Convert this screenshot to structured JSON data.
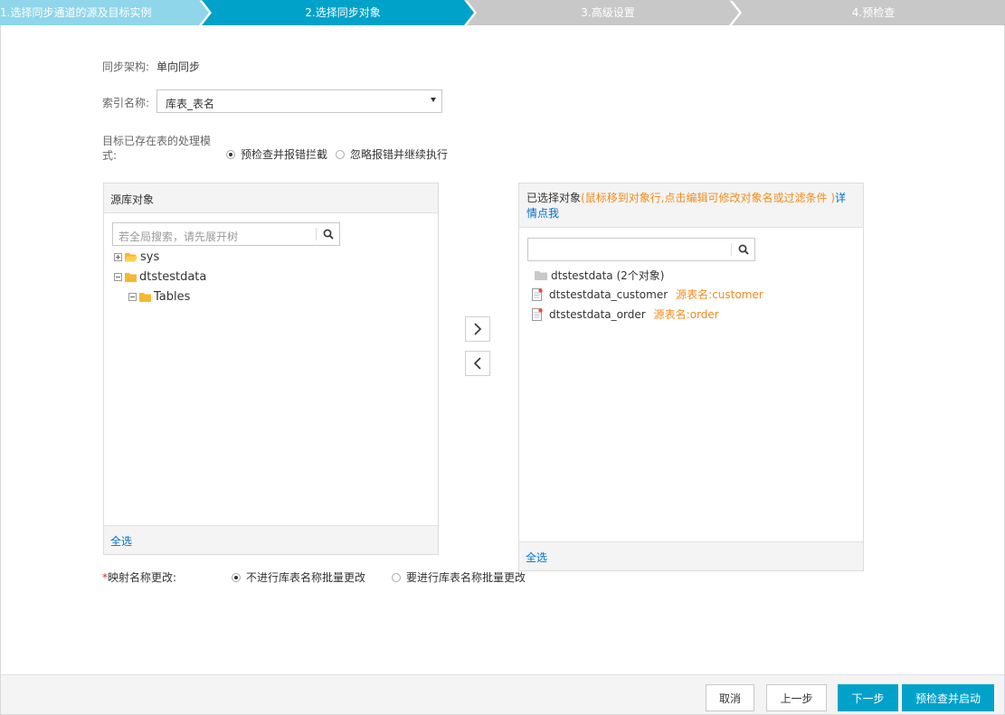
{
  "steps": [
    {
      "label": "1.选择同步通道的源及目标实例",
      "state": "done"
    },
    {
      "label": "2.选择同步对象",
      "state": "active"
    },
    {
      "label": "3.高级设置",
      "state": "todo"
    },
    {
      "label": "4.预检查",
      "state": "todo"
    }
  ],
  "colors": {
    "step_done": "#8fd6ea",
    "step_active": "#00a2ca",
    "step_todo": "#c8c8c8",
    "primary": "#00a2ca",
    "link": "#0070cc",
    "warn": "#f08c1e"
  },
  "form": {
    "sync_arch_label": "同步架构:",
    "sync_arch_value": "单向同步",
    "index_name_label": "索引名称:",
    "index_name_value": "库表_表名",
    "exist_mode_label": "目标已存在表的处理模式:",
    "exist_mode_options": [
      "预检查并报错拦截",
      "忽略报错并继续执行"
    ],
    "exist_mode_selected": 0
  },
  "source_panel": {
    "title": "源库对象",
    "search_placeholder": "若全局搜索，请先展开树",
    "tree": [
      {
        "label": "sys",
        "expanded": false,
        "level": 0
      },
      {
        "label": "dtstestdata",
        "expanded": true,
        "level": 0
      },
      {
        "label": "Tables",
        "expanded": true,
        "level": 1
      }
    ],
    "select_all": "全选"
  },
  "selected_panel": {
    "title": "已选择对象",
    "hint": "(鼠标移到对象行,点击编辑可修改对象名或过滤条件 )",
    "detail_link_1": "详",
    "detail_link_2": "情点我",
    "search_value": "",
    "group": "dtstestdata (2个对象)",
    "items": [
      {
        "name": "dtstestdata_customer",
        "source": "源表名:customer"
      },
      {
        "name": "dtstestdata_order",
        "source": "源表名:order"
      }
    ],
    "select_all": "全选"
  },
  "mapping": {
    "required_mark": "*",
    "label": "映射名称更改:",
    "options": [
      "不进行库表名称批量更改",
      "要进行库表名称批量更改"
    ],
    "selected": 0
  },
  "footer": {
    "cancel": "取消",
    "prev": "上一步",
    "next": "下一步",
    "precheck_start": "预检查并启动"
  }
}
